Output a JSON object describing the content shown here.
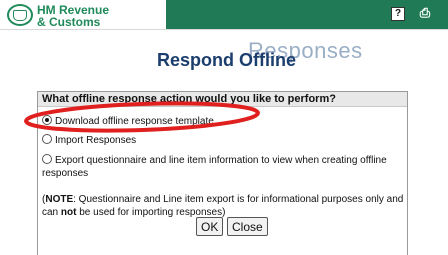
{
  "header": {
    "logo_line1": "HM Revenue",
    "logo_line2": "& Customs",
    "help_icon_glyph": "?",
    "print_icon_glyph": "⎙"
  },
  "page": {
    "title": "Respond Offline",
    "subtitle_ghost": "Responses"
  },
  "panel": {
    "question": "What offline response action would you like to perform?",
    "options": [
      {
        "label": "Download offline response template",
        "selected": true
      },
      {
        "label": "Import Responses",
        "selected": false
      },
      {
        "label": "Export questionnaire and line item information to view when creating offline responses",
        "selected": false
      }
    ],
    "note_prefix": "(",
    "note_bold": "NOTE",
    "note_text_1": ": Questionnaire and Line item export is for informational purposes only and can ",
    "note_bold_2": "not",
    "note_text_2": " be used for importing responses)"
  },
  "buttons": {
    "ok": "OK",
    "close": "Close"
  },
  "colors": {
    "brand_green": "#1f7a55",
    "heading_blue": "#1b3e6e",
    "highlight_red": "#e0201f"
  }
}
